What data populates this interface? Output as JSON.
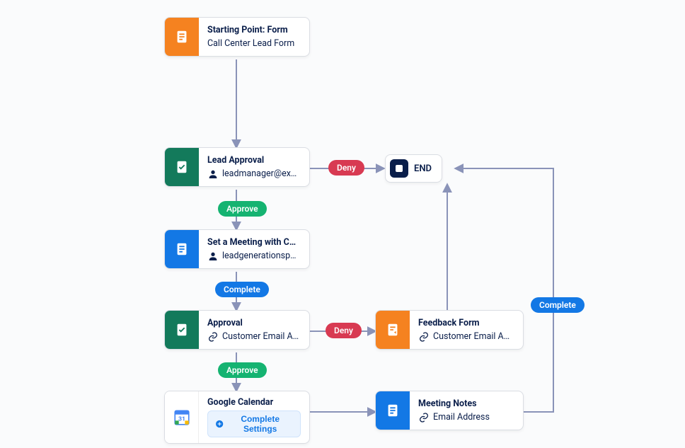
{
  "nodes": {
    "starting": {
      "title": "Starting Point: Form",
      "subtitle": "Call Center Lead Form"
    },
    "lead_approval": {
      "title": "Lead Approval",
      "subtitle": "leadmanager@exampl..."
    },
    "set_meeting": {
      "title": "Set a Meeting with Customer",
      "subtitle": "leadgenerationspecial..."
    },
    "approval": {
      "title": "Approval",
      "subtitle": "Customer Email Addr..."
    },
    "google_calendar": {
      "title": "Google Calendar",
      "button": "Complete Settings"
    },
    "feedback_form": {
      "title": "Feedback Form",
      "subtitle": "Customer Email Addr..."
    },
    "meeting_notes": {
      "title": "Meeting Notes",
      "subtitle": "Email Address"
    },
    "end": {
      "label": "END"
    }
  },
  "badges": {
    "approve1": "Approve",
    "complete1": "Complete",
    "approve2": "Approve",
    "deny1": "Deny",
    "deny2": "Deny",
    "complete2": "Complete"
  }
}
